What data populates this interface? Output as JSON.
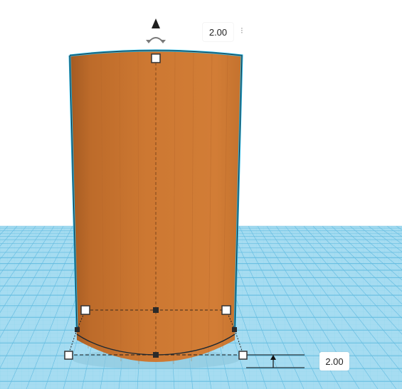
{
  "viewport": {
    "workplane_color": "#8fd0ec",
    "grid_line_color": "#5cb8dc",
    "shape_color": "#cf7a33",
    "shape_shadow_color": "#a85e24",
    "selection_outline_color": "#27b9e6"
  },
  "shape": {
    "type": "cylinder",
    "selected": true
  },
  "dimensions": {
    "top_value": "2.00",
    "bottom_value": "2.00"
  },
  "overlay": {
    "lift_arrow_icon": "up-triangle-icon",
    "rotate_icon": "rotate-arrows-icon",
    "extra_glyph": "⁝"
  }
}
